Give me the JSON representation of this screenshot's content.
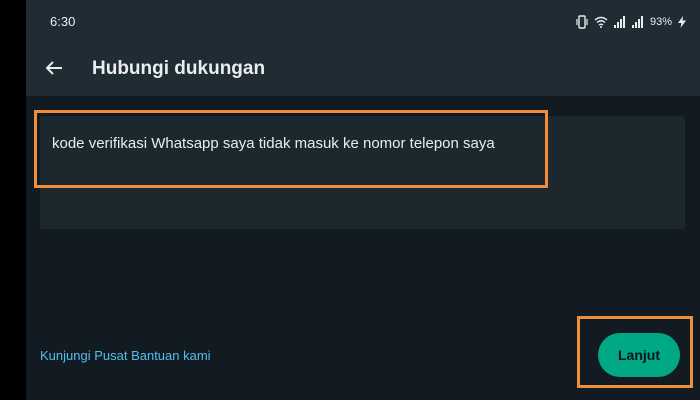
{
  "status_bar": {
    "time": "6:30",
    "battery": "93%",
    "icons": [
      "vibrate-icon",
      "wifi-icon",
      "signal-icon",
      "signal-icon",
      "battery-charging-icon"
    ]
  },
  "app_bar": {
    "back_icon": "arrow-left-icon",
    "title": "Hubungi dukungan"
  },
  "form": {
    "message_value": "kode verifikasi Whatsapp saya tidak masuk ke nomor telepon saya"
  },
  "footer": {
    "help_link": "Kunjungi Pusat Bantuan kami",
    "next_label": "Lanjut"
  },
  "colors": {
    "background": "#121b22",
    "app_bar": "#1f2c34",
    "input_bg": "#1c272e",
    "accent": "#00a884",
    "link": "#53bdeb",
    "highlight": "#f08c3a"
  }
}
